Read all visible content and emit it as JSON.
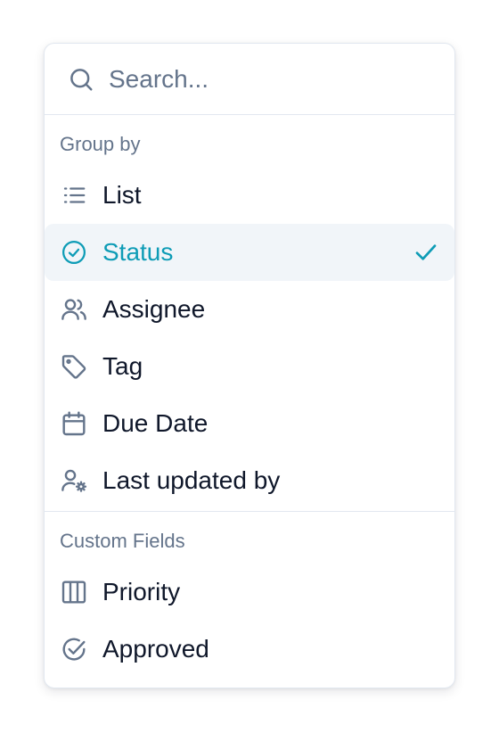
{
  "search": {
    "placeholder": "Search..."
  },
  "group_by": {
    "label": "Group by",
    "items": [
      {
        "label": "List",
        "icon": "list-icon"
      },
      {
        "label": "Status",
        "icon": "status-circle-check-icon",
        "selected": true
      },
      {
        "label": "Assignee",
        "icon": "users-icon"
      },
      {
        "label": "Tag",
        "icon": "tag-icon"
      },
      {
        "label": "Due Date",
        "icon": "calendar-icon"
      },
      {
        "label": "Last updated by",
        "icon": "user-gear-icon"
      }
    ]
  },
  "custom_fields": {
    "label": "Custom Fields",
    "items": [
      {
        "label": "Priority",
        "icon": "columns-icon"
      },
      {
        "label": "Approved",
        "icon": "circle-check-icon"
      }
    ]
  },
  "colors": {
    "accent": "#0e9cb6",
    "muted": "#64748b",
    "text": "#0f172a",
    "selected_bg": "#f1f5f9",
    "border": "#e2e8f0"
  }
}
